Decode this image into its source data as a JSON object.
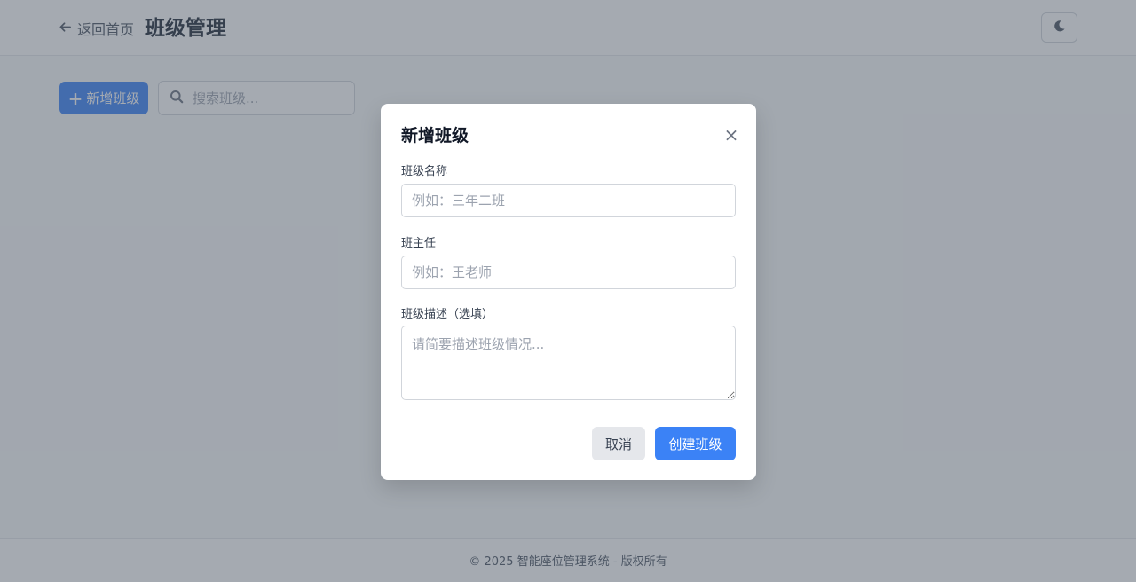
{
  "header": {
    "back_label": "返回首页",
    "title": "班级管理",
    "back_icon": "arrow-left-icon",
    "theme_icon": "moon-icon"
  },
  "toolbar": {
    "add_label": "新增班级",
    "add_icon": "plus-icon",
    "search_placeholder": "搜索班级...",
    "search_icon": "search-icon"
  },
  "footer": {
    "text": "© 2025 智能座位管理系统 - 版权所有"
  },
  "modal": {
    "title": "新增班级",
    "close_symbol": "×",
    "fields": {
      "name": {
        "label": "班级名称",
        "placeholder": "例如：三年二班",
        "value": ""
      },
      "teacher": {
        "label": "班主任",
        "placeholder": "例如：王老师",
        "value": ""
      },
      "description": {
        "label": "班级描述（选填）",
        "placeholder": "请简要描述班级情况...",
        "value": ""
      }
    },
    "cancel_label": "取消",
    "submit_label": "创建班级"
  },
  "colors": {
    "primary": "#3b82f6",
    "overlay": "rgba(75,85,99,0.5)"
  }
}
